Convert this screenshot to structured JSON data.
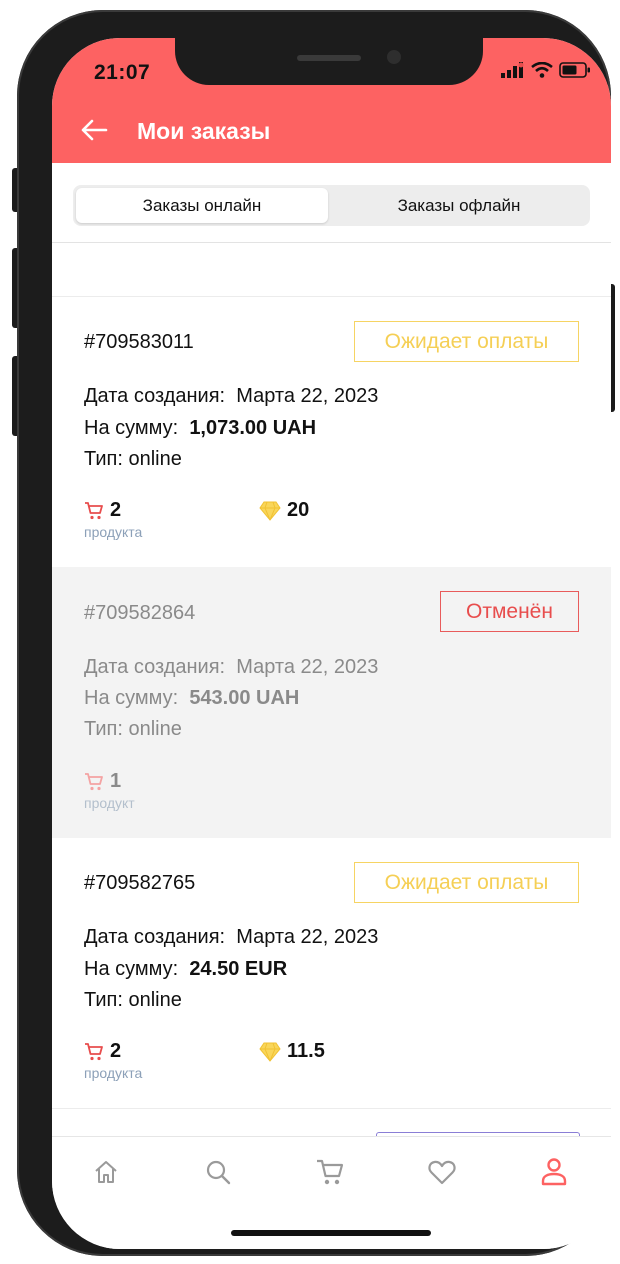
{
  "status_bar": {
    "time": "21:07"
  },
  "header": {
    "title": "Мои заказы"
  },
  "tabs": [
    {
      "label": "Заказы онлайн",
      "active": true
    },
    {
      "label": "Заказы офлайн",
      "active": false
    }
  ],
  "orders": [
    {
      "id": "#709583011",
      "status": "Ожидает оплаты",
      "date_label": "Дата создания:",
      "date": "Марта 22, 2023",
      "sum_label": "На сумму:",
      "sum": "1,073.00 UAH",
      "type": "Тип: online",
      "items_count": "2",
      "items_label": "продукта",
      "bonus": "20"
    },
    {
      "id": "#709582864",
      "status": "Отменён",
      "date_label": "Дата создания:",
      "date": "Марта 22, 2023",
      "sum_label": "На сумму:",
      "sum": "543.00 UAH",
      "type": "Тип: online",
      "items_count": "1",
      "items_label": "продукт"
    },
    {
      "id": "#709582765",
      "status": "Ожидает оплаты",
      "date_label": "Дата создания:",
      "date": "Марта 22, 2023",
      "sum_label": "На сумму:",
      "sum": "24.50 EUR",
      "type": "Тип: online",
      "items_count": "2",
      "items_label": "продукта",
      "bonus": "11.5"
    }
  ],
  "bottom_nav": [
    {
      "icon": "home-icon"
    },
    {
      "icon": "search-icon"
    },
    {
      "icon": "cart-icon"
    },
    {
      "icon": "heart-icon"
    },
    {
      "icon": "profile-icon",
      "active": true
    }
  ],
  "colors": {
    "accent": "#fd6262",
    "pending": "#f5cf55",
    "cancelled": "#e84d4d",
    "muted_label": "#8ca0b8"
  }
}
